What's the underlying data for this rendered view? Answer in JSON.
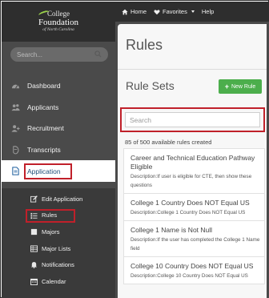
{
  "logo": {
    "line1": "College",
    "line2": "Foundation",
    "line3": "of North Carolina"
  },
  "sidebar": {
    "search_placeholder": "Search...",
    "items": [
      {
        "label": "Dashboard",
        "icon": "dashboard-icon"
      },
      {
        "label": "Applicants",
        "icon": "users-icon"
      },
      {
        "label": "Recruitment",
        "icon": "user-plus-icon"
      },
      {
        "label": "Transcripts",
        "icon": "transcripts-icon"
      },
      {
        "label": "Application",
        "icon": "document-icon",
        "active": true
      }
    ],
    "sub_items": [
      {
        "label": "Edit Application",
        "icon": "edit-icon"
      },
      {
        "label": "Rules",
        "icon": "list-icon",
        "active": true
      },
      {
        "label": "Majors",
        "icon": "square-icon"
      },
      {
        "label": "Major Lists",
        "icon": "table-icon"
      },
      {
        "label": "Notifications",
        "icon": "bell-icon"
      },
      {
        "label": "Calendar",
        "icon": "calendar-icon"
      }
    ]
  },
  "topbar": {
    "home": "Home",
    "favorites": "Favorites",
    "help": "Help"
  },
  "main": {
    "title": "Rules",
    "section_title": "Rule Sets",
    "new_button": "New Rule",
    "search_placeholder": "Search",
    "count_text": "85 of 500 available rules created",
    "rules": [
      {
        "name": "Career and Technical Education Pathway Eligible",
        "desc": "Description:If user is eligible for CTE, then show these questions"
      },
      {
        "name": "College 1 Country Does NOT Equal US",
        "desc": "Description:College 1 Country Does NOT Equal US"
      },
      {
        "name": "College 1 Name is Not Null",
        "desc": "Description:If the user has completed the College 1 Name field"
      },
      {
        "name": "College 10 Country Does NOT Equal US",
        "desc": "Description:College 10 Country Does NOT Equal US"
      }
    ]
  },
  "colors": {
    "accent_green": "#4cae4c",
    "highlight_red": "#c0202a",
    "sidebar_bg": "#4a4a4a"
  }
}
